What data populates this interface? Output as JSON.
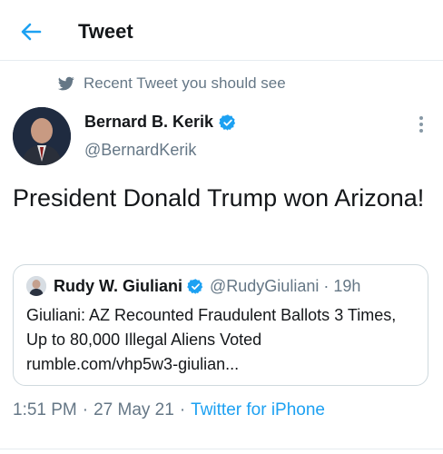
{
  "header": {
    "title": "Tweet"
  },
  "context": {
    "label": "Recent Tweet you should see"
  },
  "tweet": {
    "author_name": "Bernard B. Kerik",
    "author_handle": "@BernardKerik",
    "text": "President Donald Trump won Arizona!",
    "time": "1:51 PM",
    "date": "27 May 21",
    "source": "Twitter for iPhone",
    "separator": "·"
  },
  "quote": {
    "author_name": "Rudy W. Giuliani",
    "author_handle": "@RudyGiuliani",
    "separator": "·",
    "age": "19h",
    "text": "Giuliani: AZ Recounted Fraudulent Ballots 3 Times, Up to 80,000 Illegal Aliens Voted rumble.com/vhp5w3-giulian..."
  },
  "icons": {
    "back": "back-arrow-icon",
    "context": "twitter-bird-icon",
    "verified": "verified-badge-icon",
    "more": "more-vertical-icon"
  },
  "colors": {
    "accent": "#1da1f2",
    "secondary_text": "#657786",
    "primary_text": "#14171a"
  }
}
